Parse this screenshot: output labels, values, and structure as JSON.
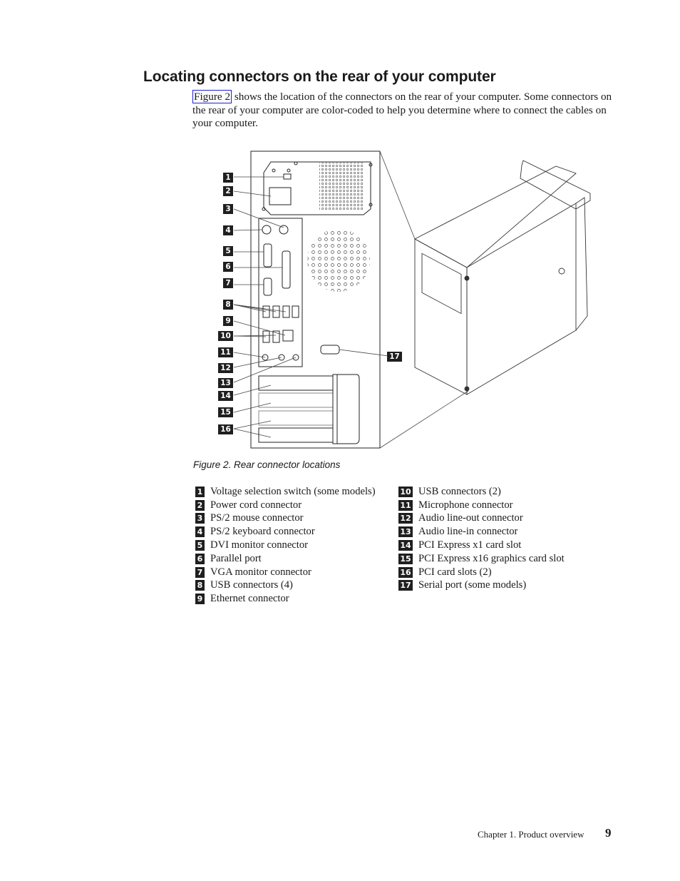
{
  "section": {
    "title": "Locating connectors on the rear of your computer",
    "intro_link": "Figure 2",
    "intro_text": " shows the location of the connectors on the rear of your computer. Some connectors on the rear of your computer are color-coded to help you determine where to connect the cables on your computer."
  },
  "figure": {
    "callouts": [
      "1",
      "2",
      "3",
      "4",
      "5",
      "6",
      "7",
      "8",
      "9",
      "10",
      "11",
      "12",
      "13",
      "14",
      "15",
      "16",
      "17"
    ],
    "caption": "Figure 2. Rear connector locations"
  },
  "legend": {
    "left": [
      {
        "num": "1",
        "label": "Voltage selection switch (some models)"
      },
      {
        "num": "2",
        "label": "Power cord connector"
      },
      {
        "num": "3",
        "label": "PS/2 mouse connector"
      },
      {
        "num": "4",
        "label": "PS/2 keyboard connector"
      },
      {
        "num": "5",
        "label": "DVI monitor connector"
      },
      {
        "num": "6",
        "label": "Parallel port"
      },
      {
        "num": "7",
        "label": "VGA monitor connector"
      },
      {
        "num": "8",
        "label": "USB connectors (4)"
      },
      {
        "num": "9",
        "label": "Ethernet connector"
      }
    ],
    "right": [
      {
        "num": "10",
        "label": "USB connectors (2)"
      },
      {
        "num": "11",
        "label": "Microphone connector"
      },
      {
        "num": "12",
        "label": "Audio line-out connector"
      },
      {
        "num": "13",
        "label": "Audio line-in connector"
      },
      {
        "num": "14",
        "label": "PCI Express x1 card slot"
      },
      {
        "num": "15",
        "label": "PCI Express x16 graphics card slot"
      },
      {
        "num": "16",
        "label": "PCI card slots (2)"
      },
      {
        "num": "17",
        "label": "Serial port (some models)"
      }
    ]
  },
  "footer": {
    "chapter": "Chapter 1. Product overview",
    "page": "9"
  }
}
